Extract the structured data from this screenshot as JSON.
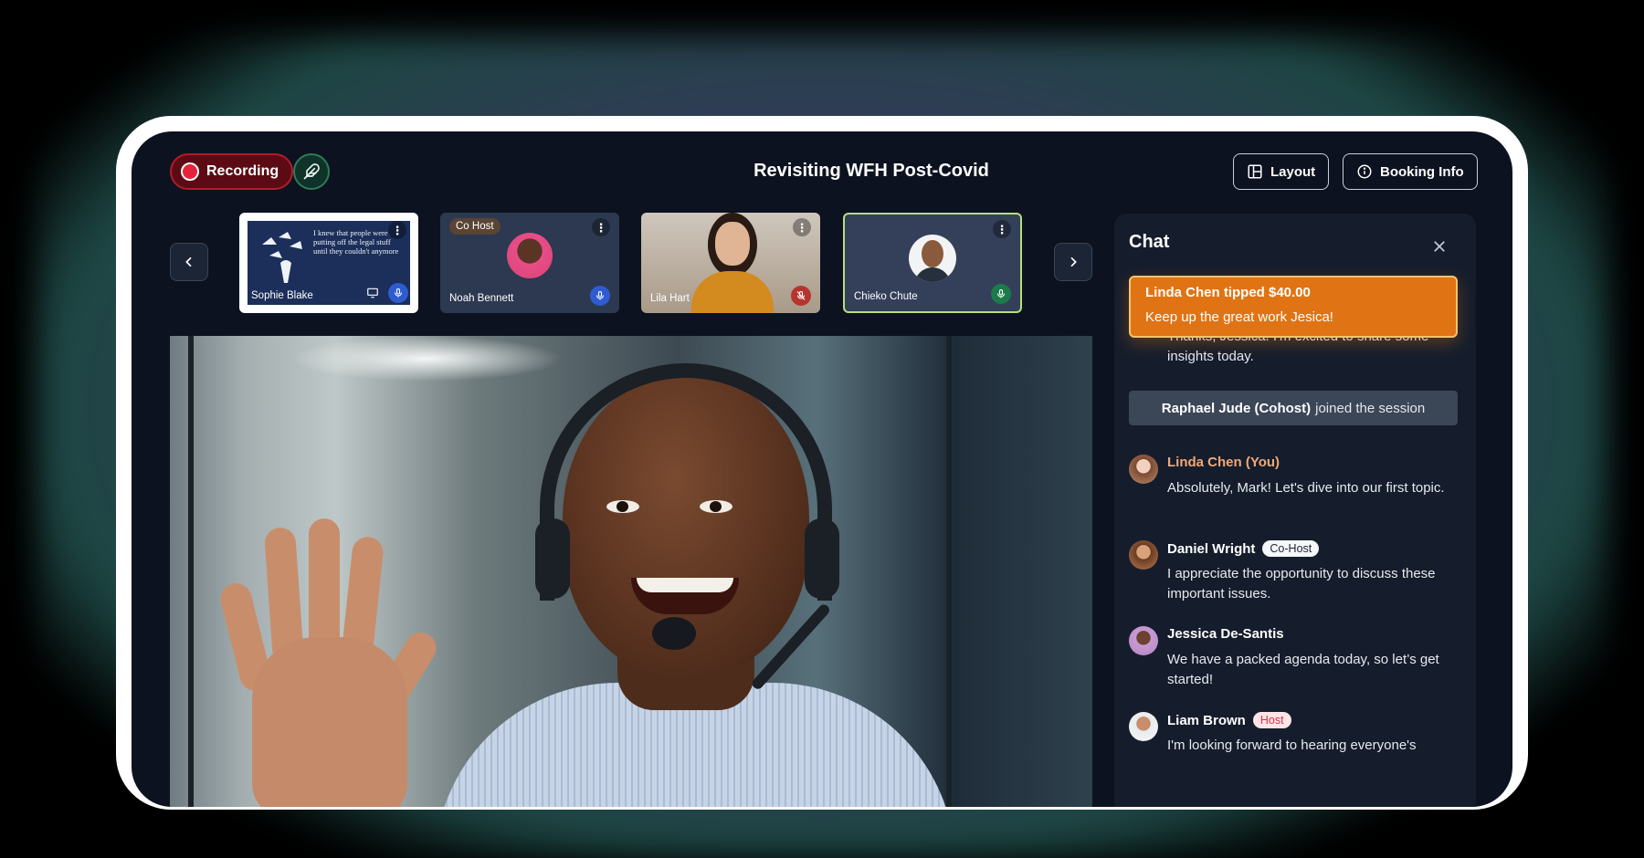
{
  "header": {
    "recording_label": "Recording",
    "title": "Revisiting WFH Post-Covid",
    "layout_label": "Layout",
    "booking_label": "Booking Info"
  },
  "participants": [
    {
      "name": "Sophie Blake",
      "slide_text": "I knew that people were putting off the legal stuff until they couldn't anymore",
      "mic": "on",
      "screen_share": true
    },
    {
      "name": "Noah Bennett",
      "tag": "Co Host",
      "mic": "on"
    },
    {
      "name": "Lila Hart",
      "mic": "muted"
    },
    {
      "name": "Chieko Chute",
      "mic": "on",
      "active": true
    }
  ],
  "chat": {
    "title": "Chat",
    "tip": {
      "title": "Linda Chen tipped $40.00",
      "message": "Keep up the great work Jesica!"
    },
    "partial_message": "Thanks, Jessica! I'm excited to share some insights today.",
    "system": {
      "name": "Raphael Jude (Cohost)",
      "text": "joined the session"
    },
    "messages": [
      {
        "name": "Linda Chen (You)",
        "text": "Absolutely, Mark! Let's dive into our first topic."
      },
      {
        "name": "Daniel Wright",
        "badge": "Co-Host",
        "text": "I appreciate the opportunity to discuss these important issues."
      },
      {
        "name": "Jessica De-Santis",
        "text": "We have a packed agenda today, so let’s get started!"
      },
      {
        "name": "Liam Brown",
        "badge": "Host",
        "text": "I'm looking forward to hearing everyone's"
      }
    ]
  },
  "colors": {
    "screen_bg": "#0c121f",
    "recording_red": "#e5243b",
    "tip_orange": "#e07415",
    "active_border": "#b7e07a"
  }
}
